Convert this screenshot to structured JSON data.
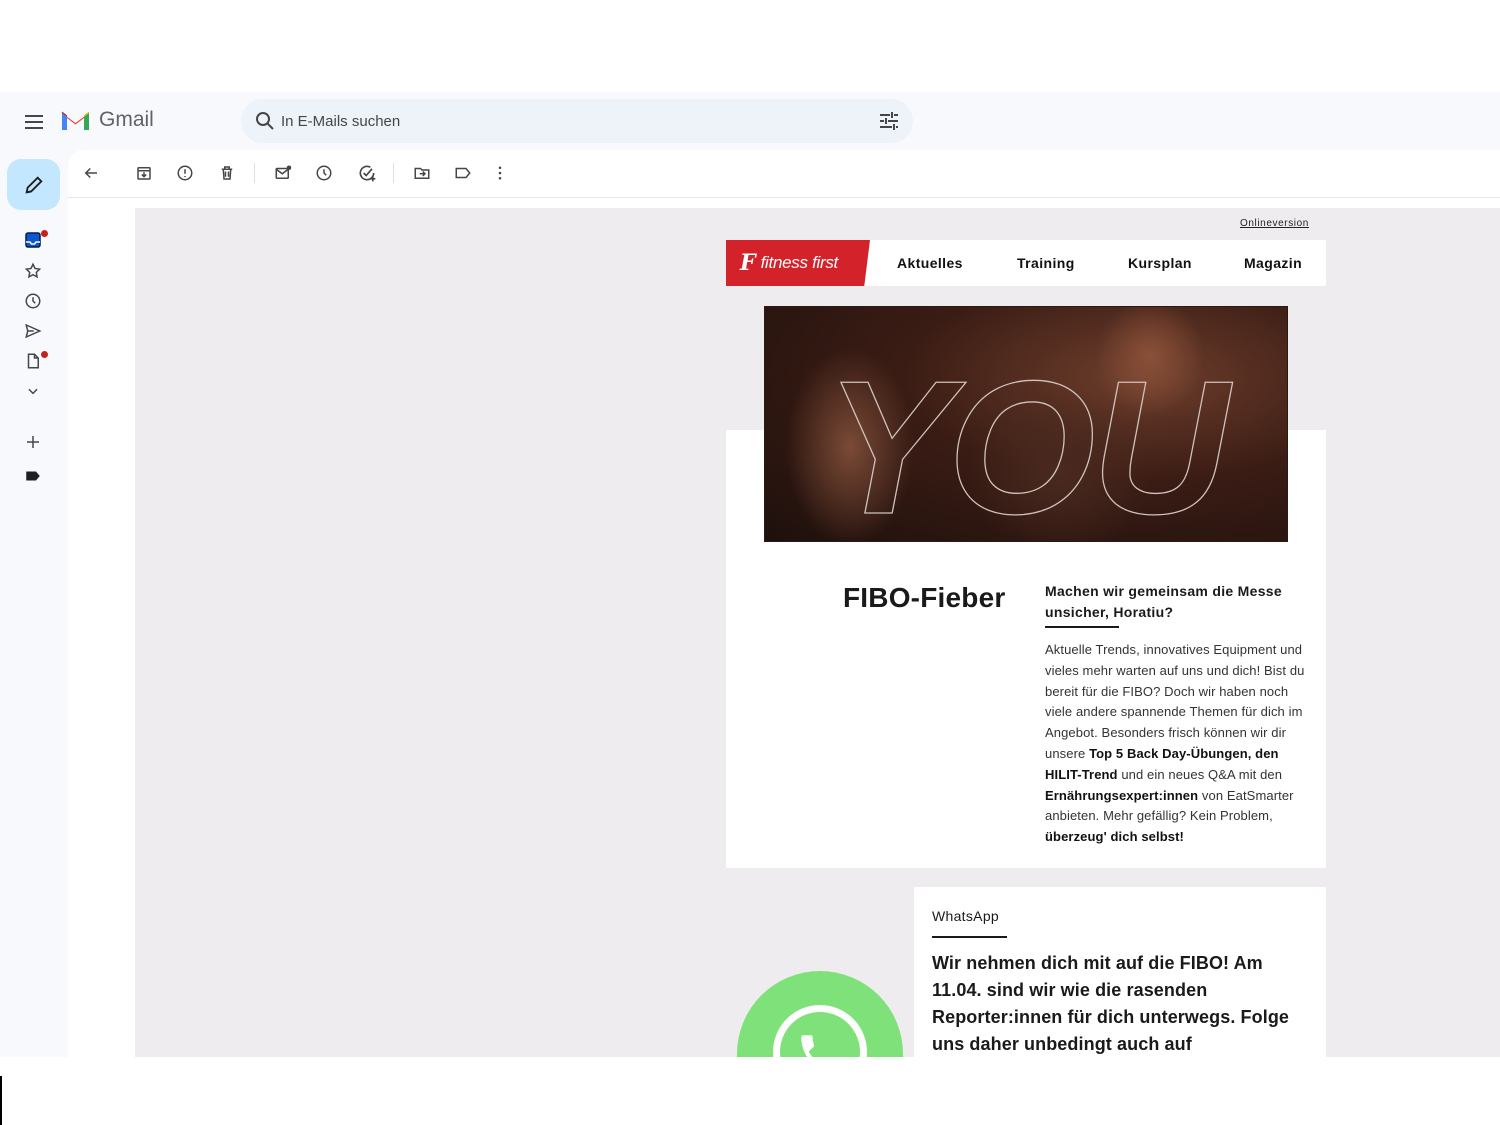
{
  "app": {
    "name": "Gmail"
  },
  "search": {
    "placeholder": "In E-Mails suchen"
  },
  "rail": {
    "items": [
      {
        "icon": "inbox-icon",
        "badge": true
      },
      {
        "icon": "star-icon",
        "badge": false
      },
      {
        "icon": "clock-icon",
        "badge": false
      },
      {
        "icon": "send-icon",
        "badge": false
      },
      {
        "icon": "draft-icon",
        "badge": true
      },
      {
        "icon": "chevron-down-icon",
        "badge": false
      },
      {
        "icon": "plus-icon",
        "badge": false
      },
      {
        "icon": "label-icon",
        "badge": false
      }
    ]
  },
  "toolbar": {
    "icons": [
      "back-icon",
      "archive-icon",
      "spam-icon",
      "delete-icon",
      "mark-unread-icon",
      "snooze-icon",
      "add-task-icon",
      "move-to-icon",
      "label-icon",
      "more-icon"
    ]
  },
  "email": {
    "online_version": "Onlineversion",
    "brand": {
      "mark": "F",
      "name": "fitness first",
      "color": "#d3222a"
    },
    "nav": [
      "Aktuelles",
      "Training",
      "Kursplan",
      "Magazin"
    ],
    "hero_text": "YOU",
    "title": "FIBO-Fieber",
    "subhead": "Machen wir gemeinsam die Messe unsicher, Horatiu?",
    "body": [
      {
        "t": "Aktuelle Trends, innovatives Equipment und vieles mehr warten auf uns und dich! Bist du bereit für die FIBO? Doch wir haben noch viele andere spannende Themen für dich im Angebot. Besonders frisch können wir dir unsere ",
        "b": false
      },
      {
        "t": "Top 5 Back Day-Übungen, den HILIT-Trend",
        "b": true
      },
      {
        "t": " und ein neues Q&A mit den ",
        "b": false
      },
      {
        "t": "Ernährungsexpert:innen",
        "b": true
      },
      {
        "t": " von EatSmarter anbieten. Mehr gefällig? Kein Problem, ",
        "b": false
      },
      {
        "t": "überzeug' dich selbst!",
        "b": true
      }
    ],
    "whatsapp": {
      "label": "WhatsApp",
      "text": "Wir nehmen dich mit auf die FIBO! Am 11.04. sind wir wie die rasenden Reporter:innen für dich unterwegs. Folge uns daher unbedingt auch auf",
      "color": "#7fe17a"
    }
  }
}
